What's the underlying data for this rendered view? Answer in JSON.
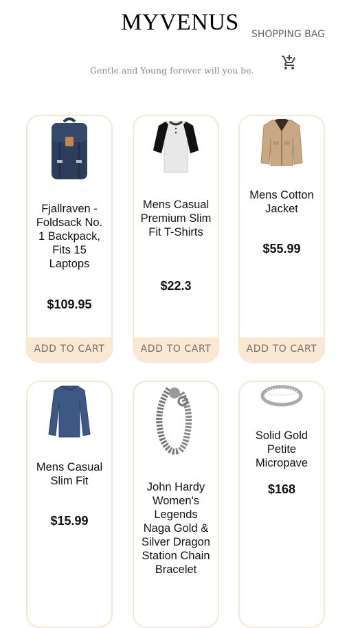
{
  "header": {
    "brand": "MYVENUS",
    "tagline": "Gentle and Young forever will you be.",
    "bag_label": "SHOPPING BAG",
    "cart_icon": "add-shopping-cart-icon"
  },
  "products": [
    {
      "title": "Fjallraven - Foldsack No. 1 Backpack, Fits 15 Laptops",
      "price": "$109.95",
      "button": "ADD TO CART",
      "image": "backpack"
    },
    {
      "title": "Mens Casual Premium Slim Fit T-Shirts",
      "price": "$22.3",
      "button": "ADD TO CART",
      "image": "raglan-tshirt"
    },
    {
      "title": "Mens Cotton Jacket",
      "price": "$55.99",
      "button": "ADD TO CART",
      "image": "cotton-jacket"
    },
    {
      "title": "Mens Casual Slim Fit",
      "price": "$15.99",
      "image": "long-sleeve-shirt"
    },
    {
      "title": "John Hardy Women's Legends Naga Gold & Silver Dragon Station Chain Bracelet",
      "image": "dragon-bracelet"
    },
    {
      "title": "Solid Gold Petite Micropave",
      "price": "$168",
      "image": "silver-ring"
    }
  ],
  "colors": {
    "card_border": "#f6e6d3",
    "button_bg": "#fbe8d2",
    "button_text": "#6e6e6e"
  }
}
